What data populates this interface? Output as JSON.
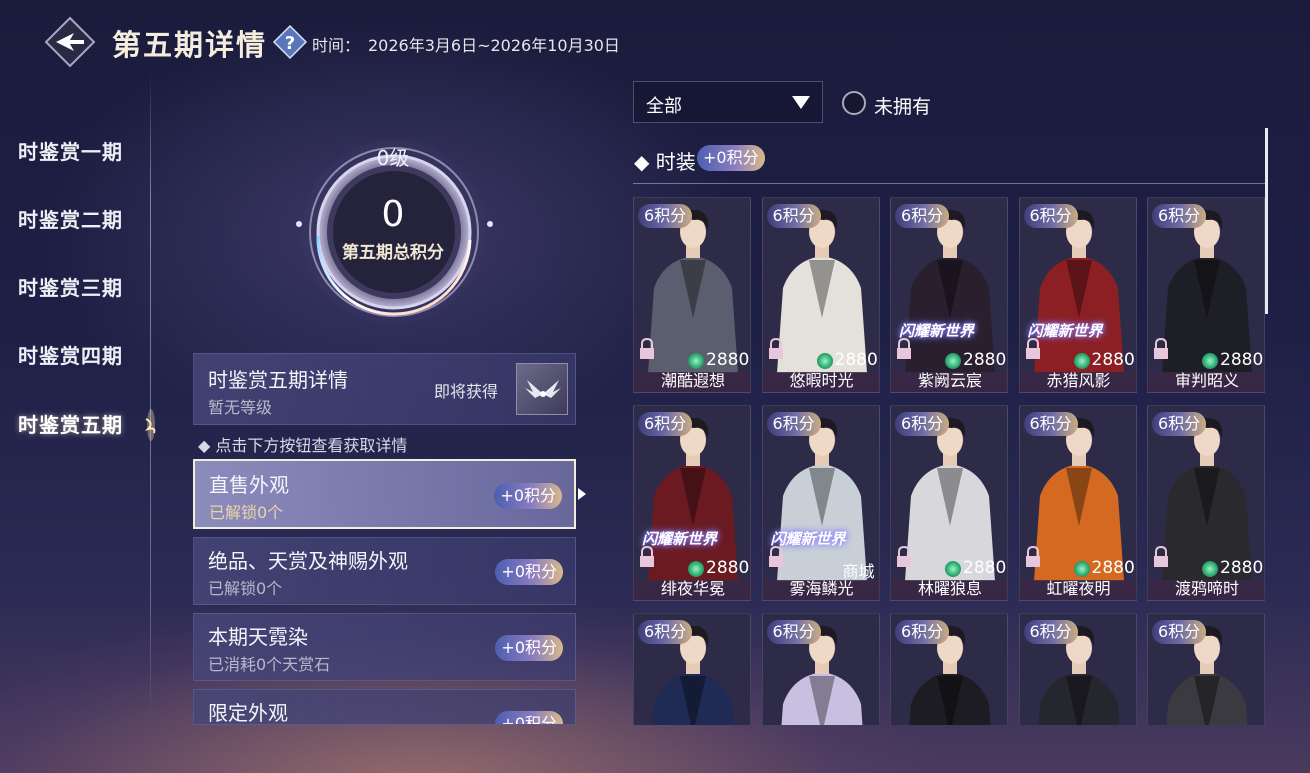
{
  "header": {
    "title": "第五期详情",
    "time_label": "时间：",
    "time_value": "2026年3月6日~2026年10月30日"
  },
  "tabs": [
    {
      "label": "时鉴赏一期"
    },
    {
      "label": "时鉴赏二期"
    },
    {
      "label": "时鉴赏三期"
    },
    {
      "label": "时鉴赏四期"
    },
    {
      "label": "时鉴赏五期",
      "active": true
    }
  ],
  "score": {
    "level": "0级",
    "value": "0",
    "label": "第五期总积分"
  },
  "detail": {
    "title": "时鉴赏五期详情",
    "subtitle": "暂无等级",
    "soon_label": "即将获得",
    "hint": "点击下方按钮查看获取详情"
  },
  "categories": [
    {
      "title": "直售外观",
      "sub": "已解锁0个",
      "points": "+0积分",
      "active": true
    },
    {
      "title": "绝品、天赏及神赐外观",
      "sub": "已解锁0个",
      "points": "+0积分"
    },
    {
      "title": "本期天霓染",
      "sub": "已消耗0个天赏石",
      "points": "+0积分"
    },
    {
      "title": "限定外观",
      "sub": "",
      "points": "+0积分"
    }
  ],
  "filter": {
    "dropdown_value": "全部",
    "radio_label": "未拥有"
  },
  "section": {
    "title": "时装",
    "points": "+0积分"
  },
  "accent_colors": {
    "pill_start": "#4d5fb0",
    "pill_end": "#d9b98a",
    "jade": "#2fae74"
  },
  "items": [
    {
      "badge": "6积分",
      "price": "2880",
      "name": "潮酷遐想",
      "coat": "#5b5e6e",
      "tag": ""
    },
    {
      "badge": "6积分",
      "price": "2880",
      "name": "悠暇时光",
      "coat": "#e4e0da",
      "tag": ""
    },
    {
      "badge": "6积分",
      "price": "2880",
      "name": "紫阙云宸",
      "coat": "#2a1f2e",
      "tag": "闪耀新世界"
    },
    {
      "badge": "6积分",
      "price": "2880",
      "name": "赤猎风影",
      "coat": "#8c1f24",
      "tag": "闪耀新世界"
    },
    {
      "badge": "6积分",
      "price": "2880",
      "name": "审判昭义",
      "coat": "#1e1e26",
      "tag": ""
    },
    {
      "badge": "6积分",
      "price": "2880",
      "name": "绯夜华冕",
      "coat": "#6b1a22",
      "tag": "闪耀新世界"
    },
    {
      "badge": "6积分",
      "price": "",
      "shop": "商城",
      "name": "雾海鳞光",
      "coat": "#c8cfd6",
      "tag": "闪耀新世界"
    },
    {
      "badge": "6积分",
      "price": "2880",
      "name": "林曜狼息",
      "coat": "#d8d8dc",
      "tag": ""
    },
    {
      "badge": "6积分",
      "price": "2880",
      "name": "虹曜夜明",
      "coat": "#d46a22",
      "tag": ""
    },
    {
      "badge": "6积分",
      "price": "2880",
      "name": "渡鸦啼时",
      "coat": "#2a2a2e",
      "tag": ""
    },
    {
      "badge": "6积分",
      "price": "",
      "name": "",
      "coat": "#1f2a55",
      "tag": ""
    },
    {
      "badge": "6积分",
      "price": "",
      "name": "",
      "coat": "#c9bfe0",
      "tag": ""
    },
    {
      "badge": "6积分",
      "price": "",
      "name": "",
      "coat": "#1c1c22",
      "tag": ""
    },
    {
      "badge": "6积分",
      "price": "",
      "name": "",
      "coat": "#26262e",
      "tag": ""
    },
    {
      "badge": "6积分",
      "price": "",
      "name": "",
      "coat": "#3a3a40",
      "tag": ""
    }
  ]
}
